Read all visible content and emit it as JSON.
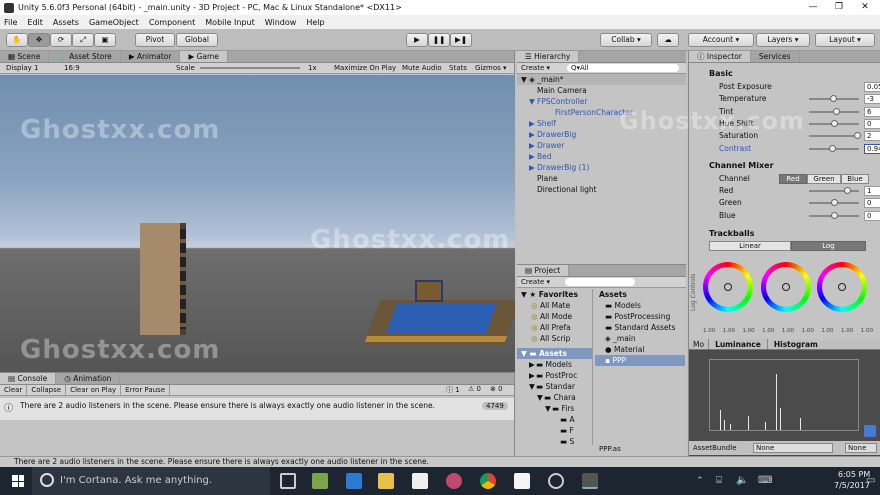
{
  "window": {
    "title": "Unity 5.6.0f3 Personal (64bit) - _main.unity - 3D Project - PC, Mac & Linux Standalone* <DX11>",
    "min": "—",
    "max": "❐",
    "close": "✕"
  },
  "menu": [
    "File",
    "Edit",
    "Assets",
    "GameObject",
    "Component",
    "Mobile Input",
    "Window",
    "Help"
  ],
  "toolbar": {
    "pivot": "Pivot",
    "global": "Global",
    "collab": "Collab ▾",
    "account": "Account ▾",
    "layers": "Layers ▾",
    "layout": "Layout ▾",
    "play": "▶",
    "pause": "❚❚",
    "step": "▶❚"
  },
  "scene_tabs": [
    "Scene",
    "Asset Store",
    "Animator",
    "Game"
  ],
  "gamebar": {
    "display": "Display 1",
    "aspect": "16:9",
    "scale_label": "Scale",
    "scale_value": "1x",
    "maximize": "Maximize On Play",
    "mute": "Mute Audio",
    "stats": "Stats",
    "gizmos": "Gizmos ▾"
  },
  "watermark": "Ghostxx.com",
  "console": {
    "tabs": [
      "Console",
      "Animation"
    ],
    "buttons": [
      "Clear",
      "Collapse",
      "Clear on Play",
      "Error Pause"
    ],
    "count_log": "1",
    "count_warn": "0",
    "count_err": "0",
    "message": "There are 2 audio listeners in the scene. Please ensure there is always exactly one audio listener in the scene.",
    "count": "4749"
  },
  "hierarchy": {
    "tab": "Hierarchy",
    "create": "Create ▾",
    "search_placeholder": "Q▾All",
    "scene": "_main*",
    "items": [
      {
        "label": "Main Camera",
        "indent": 1,
        "blue": false,
        "arrow": ""
      },
      {
        "label": "FPSController",
        "indent": 1,
        "blue": true,
        "arrow": "▼"
      },
      {
        "label": "FirstPersonCharacter",
        "indent": 2,
        "blue": true,
        "arrow": ""
      },
      {
        "label": "Shelf",
        "indent": 1,
        "blue": true,
        "arrow": "▶"
      },
      {
        "label": "DrawerBig",
        "indent": 1,
        "blue": true,
        "arrow": "▶"
      },
      {
        "label": "Drawer",
        "indent": 1,
        "blue": true,
        "arrow": "▶"
      },
      {
        "label": "Bed",
        "indent": 1,
        "blue": true,
        "arrow": "▶"
      },
      {
        "label": "DrawerBig (1)",
        "indent": 1,
        "blue": true,
        "arrow": "▶"
      },
      {
        "label": "Plane",
        "indent": 1,
        "blue": false,
        "arrow": ""
      },
      {
        "label": "Directional light",
        "indent": 1,
        "blue": false,
        "arrow": ""
      }
    ]
  },
  "project": {
    "tab": "Project",
    "create": "Create ▾",
    "favorites": "Favorites",
    "fav_items": [
      "All Mate",
      "All Mode",
      "All Prefa",
      "All Scrip"
    ],
    "assets": "Assets",
    "tree": [
      "Models",
      "PostProc",
      "Standar",
      "Chara",
      "Firs",
      "A",
      "F",
      "S"
    ],
    "asset_items": [
      "Models",
      "PostProcessing",
      "Standard Assets",
      "_main",
      "Material",
      "PPP"
    ],
    "footer": "PPP.as"
  },
  "inspector": {
    "tabs": [
      "Inspector",
      "Services"
    ],
    "basic": "Basic",
    "rows": [
      {
        "label": "Post Exposure",
        "value": "0.05",
        "slider": false
      },
      {
        "label": "Temperature",
        "value": "-3",
        "slider": true,
        "pos": 0.47
      },
      {
        "label": "Tint",
        "value": "6",
        "slider": true,
        "pos": 0.53
      },
      {
        "label": "Hue Shift",
        "value": "0",
        "slider": true,
        "pos": 0.5
      },
      {
        "label": "Saturation",
        "value": "2",
        "slider": true,
        "pos": 0.95
      },
      {
        "label": "Contrast",
        "value": "0.94",
        "slider": true,
        "pos": 0.45
      }
    ],
    "channel_mixer": "Channel Mixer",
    "channel_label": "Channel",
    "channel_buttons": [
      "Red",
      "Green",
      "Blue"
    ],
    "mix_rows": [
      {
        "label": "Red",
        "value": "1",
        "pos": 0.75
      },
      {
        "label": "Green",
        "value": "0",
        "pos": 0.5
      },
      {
        "label": "Blue",
        "value": "0",
        "pos": 0.5
      }
    ],
    "trackballs": "Trackballs",
    "tb_modes": [
      "Linear",
      "Log"
    ],
    "log_controls": "Log Controls",
    "tb_values": [
      "1.00",
      "1.00",
      "1.00",
      "1.00",
      "1.00",
      "1.00",
      "1.00",
      "1.00",
      "1.00"
    ]
  },
  "histogram": {
    "tabs": [
      "Mo",
      "Luminance",
      "Histogram"
    ],
    "asset_bundle": "AssetBundle",
    "none1": "None",
    "none2": "None"
  },
  "statusbar": "There are 2 audio listeners in the scene. Please ensure there is always exactly one audio listener in the scene.",
  "taskbar": {
    "search": "I'm Cortana. Ask me anything.",
    "time": "6:05 PM",
    "date": "7/5/2017"
  }
}
